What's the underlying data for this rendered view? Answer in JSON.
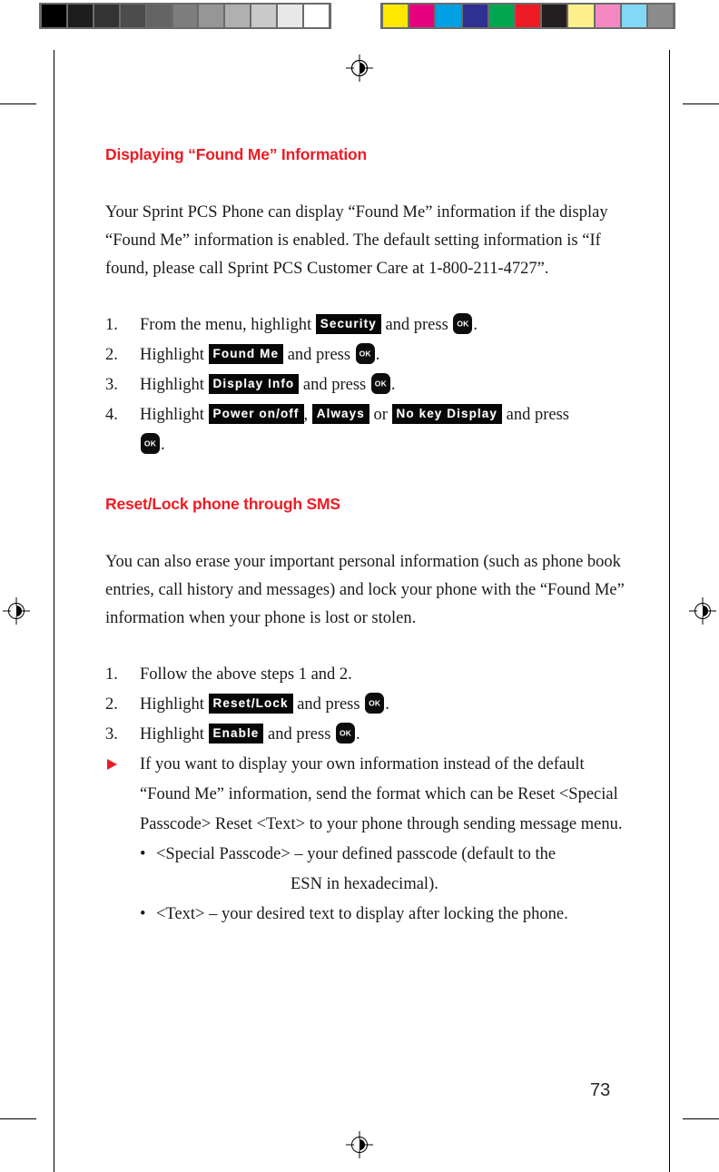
{
  "page": {
    "number": "73"
  },
  "sections": [
    {
      "heading": "Displaying “Found Me” Information",
      "paragraph": "Your Sprint PCS Phone can display “Found Me” information if the display “Found Me” information is enabled.\nThe default setting information is “If found, please call Sprint PCS Customer Care at 1-800-211-4727”."
    },
    {
      "heading": "Reset/Lock phone through SMS",
      "paragraph": "You can also erase your important personal information (such as phone book entries, call history and messages) and lock your phone with the “Found Me” information when your phone is lost or stolen."
    }
  ],
  "steps_one": {
    "items": [
      {
        "num": "1.",
        "pre": "From the menu, highlight",
        "chip": "Security",
        "mid": "and press",
        "post": "."
      },
      {
        "num": "2.",
        "pre": "Highlight",
        "chip": "Found Me",
        "mid": "and press",
        "post": "."
      },
      {
        "num": "3.",
        "pre": "Highlight",
        "chip": "Display Info",
        "mid": "and press",
        "post": "."
      },
      {
        "num": "4.",
        "pre": "Highlight",
        "chip": "Power on/off",
        "sep1": ",",
        "chip2": "Always",
        "mid": "or",
        "chip3": "No key Display",
        "tail": "and press",
        "post": "."
      }
    ]
  },
  "steps_two": {
    "items": [
      {
        "num": "1.",
        "text": "Follow the above steps 1 and 2."
      },
      {
        "num": "2.",
        "pre": "Highlight",
        "chip": "Reset/Lock",
        "mid": "and press",
        "post": "."
      },
      {
        "num": "3.",
        "pre": "Highlight",
        "chip": "Enable",
        "mid": "and press",
        "post": "."
      }
    ]
  },
  "note": {
    "text": "If you want to display your own information instead of the default “Found Me” information, send the format which can be Reset <Special Passcode> Reset <Text> to your phone through sending message menu."
  },
  "sub_bullets": [
    {
      "dot": "•",
      "text": "<Special Passcode> – your defined passcode (default to the",
      "cont": "ESN in hexadecimal)."
    },
    {
      "dot": "•",
      "text": "<Text> – your desired text to display after locking the phone."
    }
  ],
  "ok_key": {
    "label": "OK"
  },
  "calibration": {
    "grayscale": [
      "#000000",
      "#1d1d1d",
      "#333333",
      "#4c4c4c",
      "#646464",
      "#7d7d7d",
      "#969696",
      "#b0b0b0",
      "#c9c9c9",
      "#e8e8e8",
      "#ffffff"
    ],
    "colors": [
      "#ffe800",
      "#e6007e",
      "#00a0e3",
      "#2e3192",
      "#00a650",
      "#ed1c24",
      "#231f20",
      "#fdf08a",
      "#f488c0",
      "#81d8f7",
      "#8c8c8c"
    ]
  },
  "accent_color": "#ed1c24"
}
